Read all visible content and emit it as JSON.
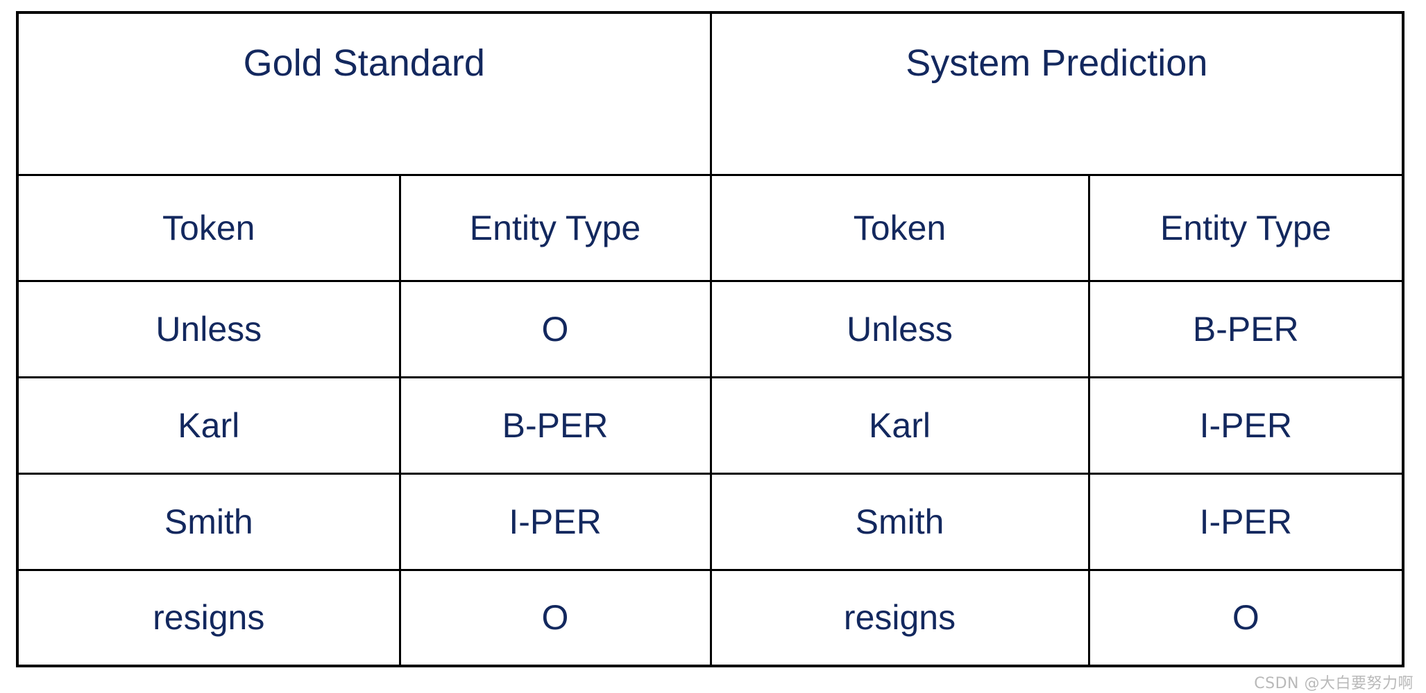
{
  "table": {
    "group_headers": [
      {
        "label": "Gold Standard",
        "span": 2
      },
      {
        "label": "System Prediction",
        "span": 2
      }
    ],
    "column_headers": [
      "Token",
      "Entity Type",
      "Token",
      "Entity Type"
    ],
    "rows": [
      [
        "Unless",
        "O",
        "Unless",
        "B-PER"
      ],
      [
        "Karl",
        "B-PER",
        "Karl",
        "I-PER"
      ],
      [
        "Smith",
        "I-PER",
        "Smith",
        "I-PER"
      ],
      [
        "resigns",
        "O",
        "resigns",
        "O"
      ]
    ]
  },
  "watermark": {
    "text": "CSDN @大白要努力啊"
  },
  "colors": {
    "text": "#13285e",
    "border": "#000000",
    "background": "#ffffff",
    "watermark": "#b9b9b9"
  }
}
